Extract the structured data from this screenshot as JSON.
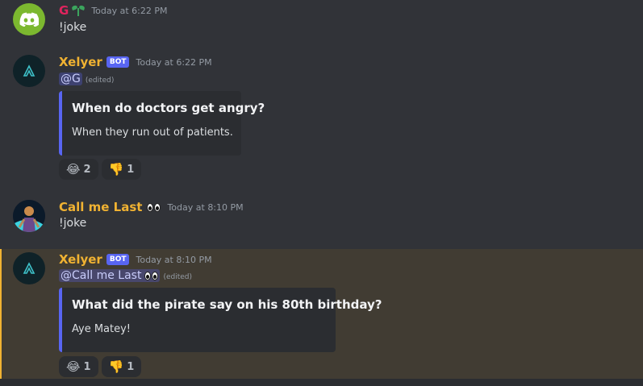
{
  "messages": [
    {
      "username": "G",
      "timestamp": "Today at 6:22 PM",
      "text": "!joke"
    },
    {
      "username": "Xelyer",
      "bot_tag": "BOT",
      "timestamp": "Today at 6:22 PM",
      "mention": "@G",
      "edited": "(edited)",
      "embed": {
        "title": "When do doctors get angry?",
        "description": "When they run out of patients."
      },
      "reactions": [
        {
          "emoji": "😂",
          "count": "2"
        },
        {
          "emoji": "👎",
          "count": "1"
        }
      ]
    },
    {
      "username": "Call me Last",
      "timestamp": "Today at 8:10 PM",
      "text": "!joke"
    },
    {
      "username": "Xelyer",
      "bot_tag": "BOT",
      "timestamp": "Today at 8:10 PM",
      "mention": "@Call me Last",
      "edited": "(edited)",
      "embed": {
        "title": "What did the pirate say on his 80th birthday?",
        "description": "Aye Matey!"
      },
      "reactions": [
        {
          "emoji": "😂",
          "count": "1"
        },
        {
          "emoji": "👎",
          "count": "1"
        }
      ]
    }
  ],
  "colors": {
    "background": "#313338",
    "highlight": "#413c33",
    "bot_name": "#f0b232",
    "embed_border": "#5865f2"
  }
}
